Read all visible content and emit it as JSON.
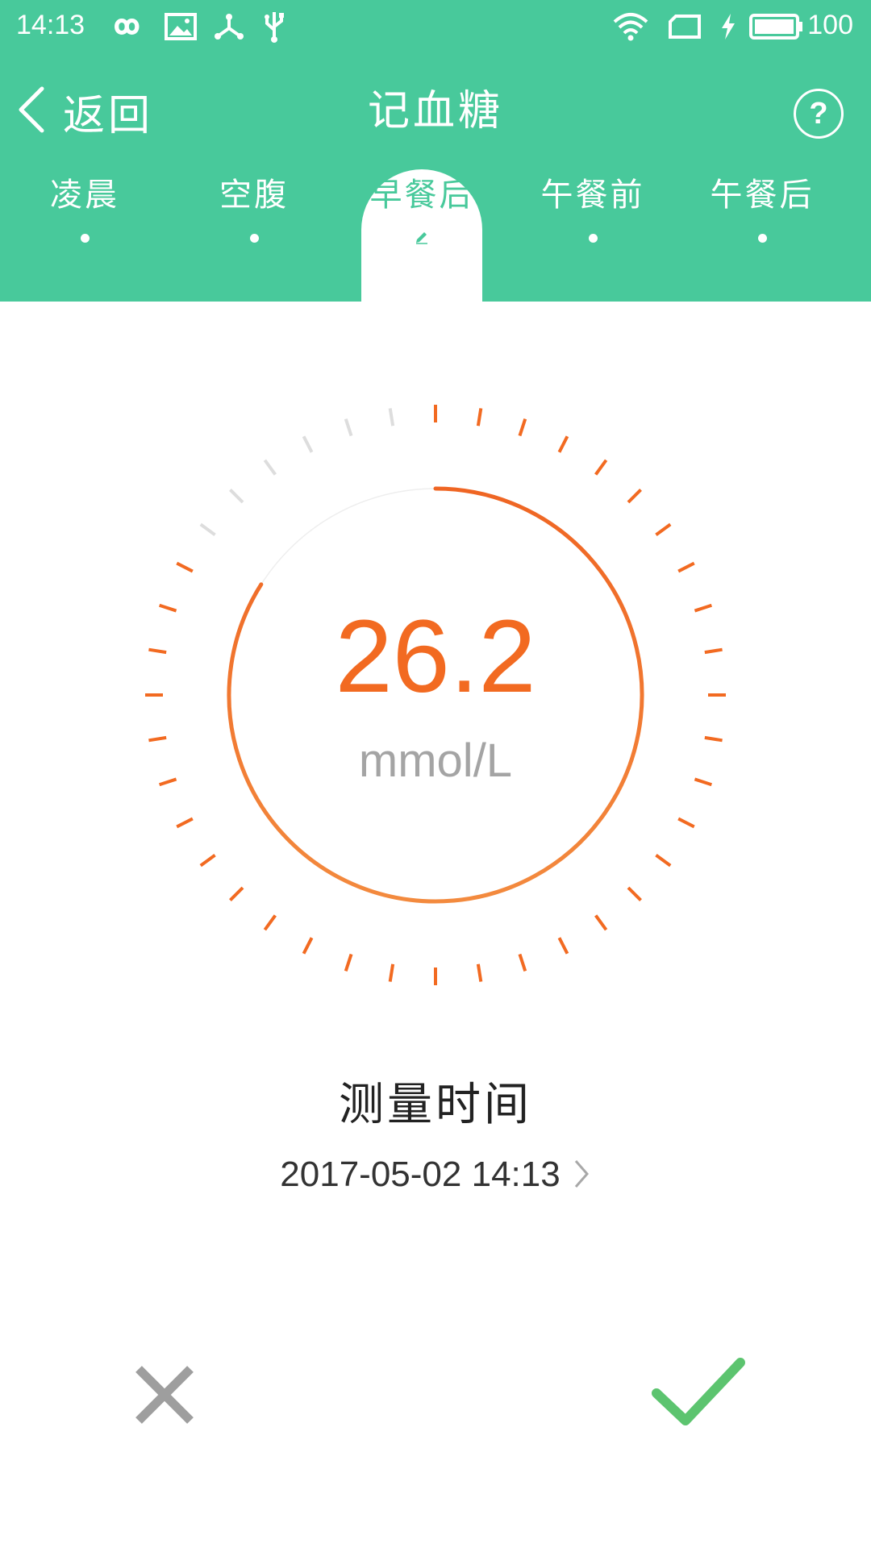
{
  "status_bar": {
    "time": "14:13",
    "battery_level": "100",
    "icons": [
      "infinity-icon",
      "image-icon",
      "share-icon",
      "usb-icon",
      "wifi-icon",
      "sim-icon",
      "charging-icon",
      "battery-icon"
    ]
  },
  "nav": {
    "back_label": "返回",
    "title": "记血糖",
    "help_label": "?"
  },
  "tabs": [
    {
      "label": "凌晨",
      "active": false
    },
    {
      "label": "空腹",
      "active": false
    },
    {
      "label": "早餐后",
      "active": true
    },
    {
      "label": "午餐前",
      "active": false
    },
    {
      "label": "午餐后",
      "active": false
    }
  ],
  "reading": {
    "value": "26.2",
    "unit": "mmol/L",
    "gauge_fill_fraction": 0.84
  },
  "measurement": {
    "label": "测量时间",
    "datetime": "2017-05-02 14:13"
  },
  "colors": {
    "header_green": "#48C99B",
    "reading_orange": "#F26A21",
    "confirm_green": "#5CC46F",
    "inactive_tick_gray": "#DDDDDD",
    "cancel_gray": "#9E9E9E"
  }
}
